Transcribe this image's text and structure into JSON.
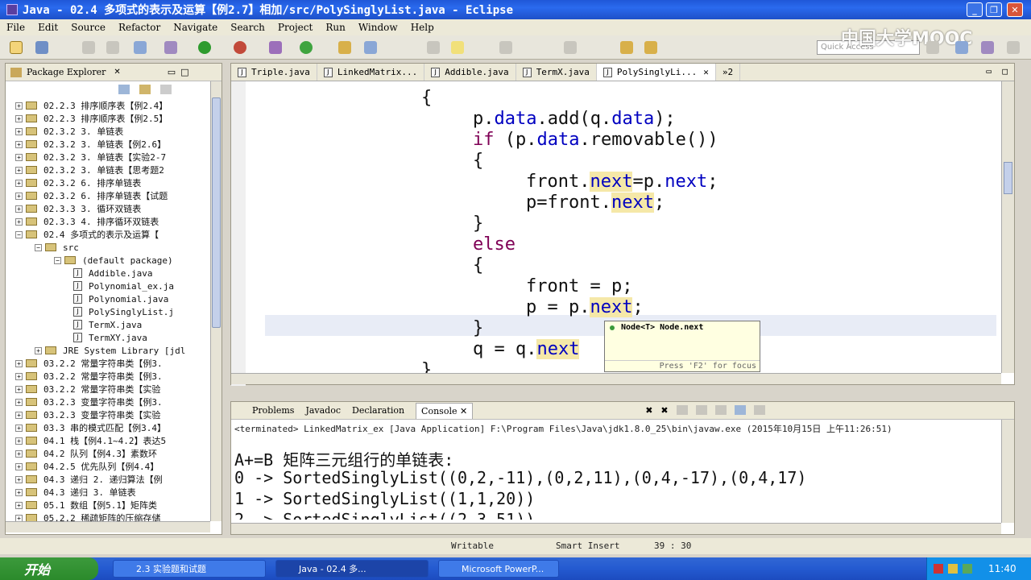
{
  "window": {
    "title": "Java - 02.4  多项式的表示及运算【例2.7】相加/src/PolySinglyList.java - Eclipse"
  },
  "menu": [
    "File",
    "Edit",
    "Source",
    "Refactor",
    "Navigate",
    "Search",
    "Project",
    "Run",
    "Window",
    "Help"
  ],
  "quick_access": {
    "placeholder": "Quick Access"
  },
  "watermark": "中国大学MOOC",
  "package_explorer": {
    "title": "Package Explorer",
    "items": [
      {
        "label": "02.2.3  排序顺序表【例2.4】",
        "indent": 0
      },
      {
        "label": "02.2.3  排序顺序表【例2.5】",
        "indent": 0
      },
      {
        "label": "02.3.2  3. 单链表",
        "indent": 0
      },
      {
        "label": "02.3.2  3. 单链表【例2.6】",
        "indent": 0
      },
      {
        "label": "02.3.2  3. 单链表【实验2-7",
        "indent": 0
      },
      {
        "label": "02.3.2  3. 单链表【思考题2",
        "indent": 0
      },
      {
        "label": "02.3.2  6. 排序单链表",
        "indent": 0
      },
      {
        "label": "02.3.2  6. 排序单链表【试题",
        "indent": 0
      },
      {
        "label": "02.3.3  3. 循环双链表",
        "indent": 0
      },
      {
        "label": "02.3.3  4. 排序循环双链表",
        "indent": 0
      },
      {
        "label": "02.4  多项式的表示及运算【",
        "indent": 0
      },
      {
        "label": "src",
        "indent": 1
      },
      {
        "label": "(default package)",
        "indent": 2
      },
      {
        "label": "Addible.java",
        "indent": 3
      },
      {
        "label": "Polynomial_ex.ja",
        "indent": 3
      },
      {
        "label": "Polynomial.java",
        "indent": 3
      },
      {
        "label": "PolySinglyList.j",
        "indent": 3
      },
      {
        "label": "TermX.java",
        "indent": 3
      },
      {
        "label": "TermXY.java",
        "indent": 3
      },
      {
        "label": "JRE System Library [jdl",
        "indent": 1
      },
      {
        "label": "03.2.2  常量字符串类【例3.",
        "indent": 0
      },
      {
        "label": "03.2.2  常量字符串类【例3.",
        "indent": 0
      },
      {
        "label": "03.2.2  常量字符串类【实验",
        "indent": 0
      },
      {
        "label": "03.2.3  变量字符串类【例3.",
        "indent": 0
      },
      {
        "label": "03.2.3  变量字符串类【实验",
        "indent": 0
      },
      {
        "label": "03.3  串的模式匹配【例3.4】",
        "indent": 0
      },
      {
        "label": "04.1  栈【例4.1~4.2】表达5",
        "indent": 0
      },
      {
        "label": "04.2  队列【例4.3】素数环",
        "indent": 0
      },
      {
        "label": "04.2.5  优先队列【例4.4】",
        "indent": 0
      },
      {
        "label": "04.3  递归 2. 递归算法【例",
        "indent": 0
      },
      {
        "label": "04.3  递归 3. 单链表",
        "indent": 0
      },
      {
        "label": "05.1  数组【例5.1】矩阵类",
        "indent": 0
      },
      {
        "label": "05.2.2  稀疏矩阵的压缩存储",
        "indent": 0
      }
    ]
  },
  "editor": {
    "tabs": [
      "Triple.java",
      "LinkedMatrix...",
      "Addible.java",
      "TermX.java",
      "PolySinglyLi...",
      "»2"
    ],
    "code": {
      "l1": "{",
      "l2a": "p.",
      "l2b": "data",
      "l2c": ".add(q.",
      "l2d": "data",
      "l2e": ");",
      "l3a": "if",
      "l3b": " (p.",
      "l3c": "data",
      "l3d": ".removable())",
      "l4": "{",
      "l5a": "front.",
      "l5b": "next",
      "l5c": "=p.",
      "l5d": "next",
      "l5e": ";",
      "l6a": "p=front.",
      "l6b": "next",
      "l6c": ";",
      "l7": "}",
      "l8": "else",
      "l9": "{",
      "l10": "front = p;",
      "l11a": "p = p.",
      "l11b": "next",
      "l11c": ";",
      "l12": "}",
      "l13a": "q = q.",
      "l13b": "next",
      "l14": "}"
    },
    "popup": {
      "title": "Node<T> Node.next",
      "hint": "Press 'F2' for focus"
    }
  },
  "console": {
    "tabs": [
      "Problems",
      "Javadoc",
      "Declaration",
      "Console"
    ],
    "terminated": "<terminated> LinkedMatrix_ex [Java Application] F:\\Program Files\\Java\\jdk1.8.0_25\\bin\\javaw.exe (2015年10月15日 上午11:26:51)",
    "lines": [
      "A+=B 矩阵三元组行的单链表:",
      "0 -> SortedSinglyList((0,2,-11),(0,2,11),(0,4,-17),(0,4,17)",
      "1 -> SortedSinglyList((1,1,20))",
      "2 -> SortedSinglyList((2,3,51))"
    ]
  },
  "status": {
    "writable": "Writable",
    "insert_mode": "Smart Insert",
    "position": "39 : 30"
  },
  "taskbar": {
    "start": "开始",
    "tasks": [
      "2.3 实验题和试题",
      "Java - 02.4 多...",
      "Microsoft PowerP..."
    ],
    "clock": "11:40"
  }
}
